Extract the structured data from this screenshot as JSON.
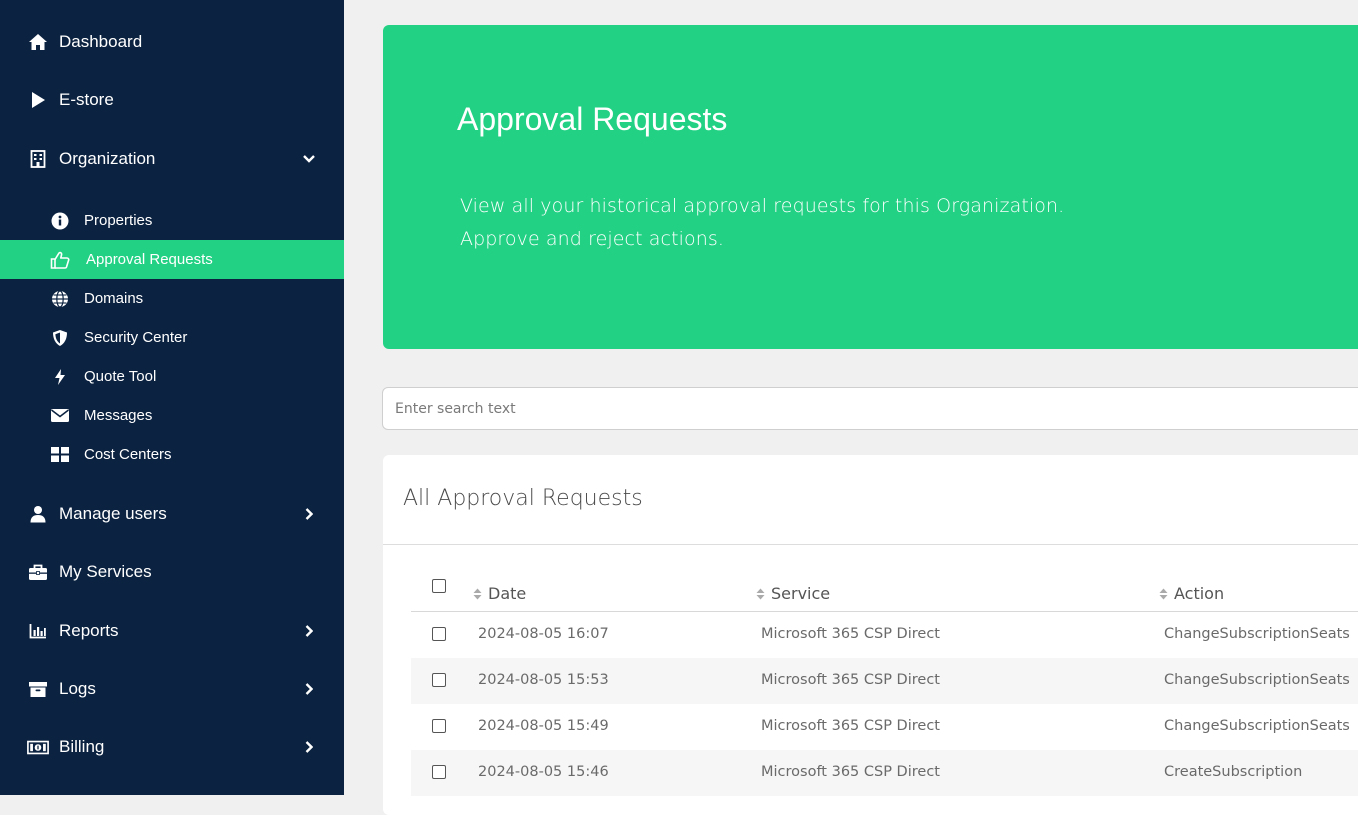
{
  "sidebar": {
    "items": [
      {
        "label": "Dashboard",
        "icon": "home-icon"
      },
      {
        "label": "E-store",
        "icon": "play-icon"
      },
      {
        "label": "Organization",
        "icon": "building-icon"
      },
      {
        "label": "Manage users",
        "icon": "user-icon"
      },
      {
        "label": "My Services",
        "icon": "briefcase-icon"
      },
      {
        "label": "Reports",
        "icon": "bar-chart-icon"
      },
      {
        "label": "Logs",
        "icon": "archive-icon"
      },
      {
        "label": "Billing",
        "icon": "money-icon"
      }
    ],
    "sub_items": [
      {
        "label": "Properties",
        "icon": "info-icon"
      },
      {
        "label": "Approval Requests",
        "icon": "thumbs-up-icon"
      },
      {
        "label": "Domains",
        "icon": "globe-icon"
      },
      {
        "label": "Security Center",
        "icon": "shield-icon"
      },
      {
        "label": "Quote Tool",
        "icon": "bolt-icon"
      },
      {
        "label": "Messages",
        "icon": "envelope-icon"
      },
      {
        "label": "Cost Centers",
        "icon": "grid-icon"
      }
    ],
    "active_sub_item": "Approval Requests"
  },
  "banner": {
    "title": "Approval Requests",
    "line1": "View all your historical approval requests for this Organization.",
    "line2": "Approve and reject actions."
  },
  "search": {
    "placeholder": "Enter search text",
    "value": ""
  },
  "card": {
    "title": "All Approval Requests",
    "columns": [
      "Date",
      "Service",
      "Action"
    ],
    "rows": [
      {
        "date": "2024-08-05 16:07",
        "service": "Microsoft 365 CSP Direct",
        "action": "ChangeSubscriptionSeats"
      },
      {
        "date": "2024-08-05 15:53",
        "service": "Microsoft 365 CSP Direct",
        "action": "ChangeSubscriptionSeats"
      },
      {
        "date": "2024-08-05 15:49",
        "service": "Microsoft 365 CSP Direct",
        "action": "ChangeSubscriptionSeats"
      },
      {
        "date": "2024-08-05 15:46",
        "service": "Microsoft 365 CSP Direct",
        "action": "CreateSubscription"
      }
    ]
  },
  "colors": {
    "sidebar_bg": "#0b2240",
    "accent": "#22d184",
    "page_bg": "#f0f0f0"
  }
}
